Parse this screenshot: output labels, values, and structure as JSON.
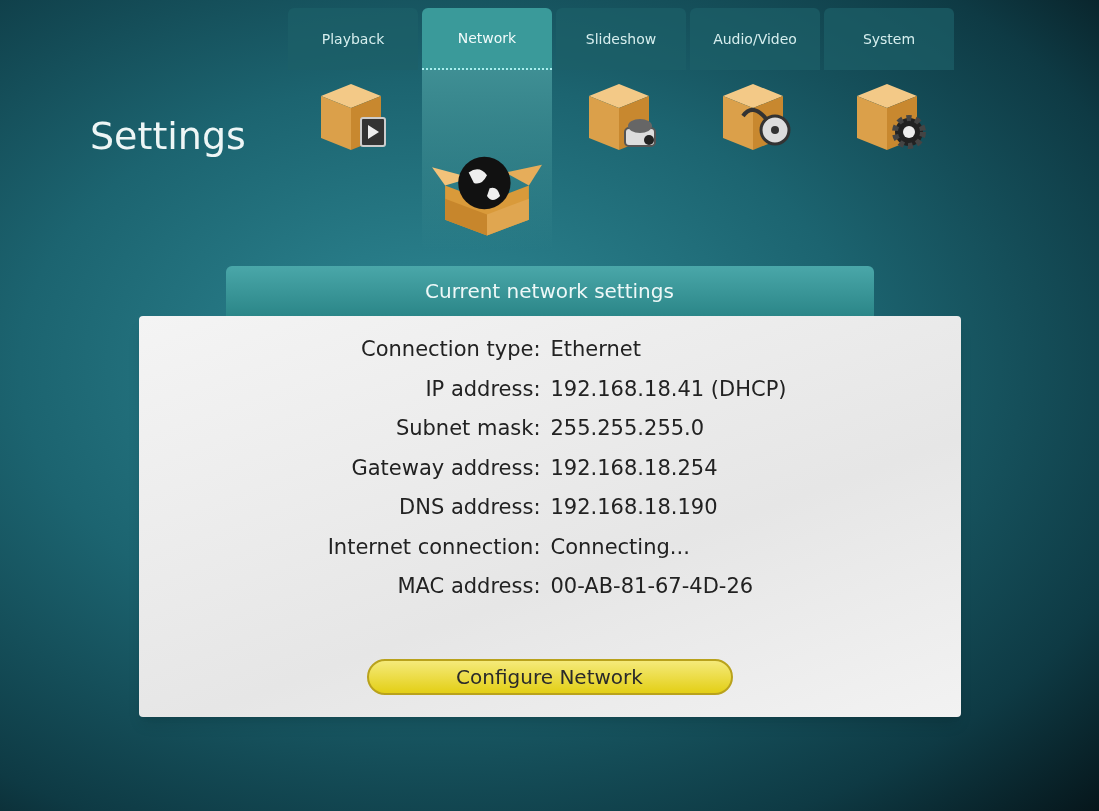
{
  "title": "Settings",
  "tabs": [
    {
      "label": "Playback",
      "selected": false
    },
    {
      "label": "Network",
      "selected": true
    },
    {
      "label": "Slideshow",
      "selected": false
    },
    {
      "label": "Audio/Video",
      "selected": false
    },
    {
      "label": "System",
      "selected": false
    }
  ],
  "panel": {
    "title": "Current network settings",
    "rows": [
      {
        "label": "Connection type:",
        "value": "Ethernet"
      },
      {
        "label": "IP address:",
        "value": "192.168.18.41 (DHCP)"
      },
      {
        "label": "Subnet mask:",
        "value": "255.255.255.0"
      },
      {
        "label": "Gateway address:",
        "value": "192.168.18.254"
      },
      {
        "label": "DNS address:",
        "value": "192.168.18.190"
      },
      {
        "label": "Internet connection:",
        "value": "Connecting..."
      },
      {
        "label": "MAC address:",
        "value": "00-AB-81-67-4D-26"
      }
    ],
    "button": "Configure Network"
  }
}
